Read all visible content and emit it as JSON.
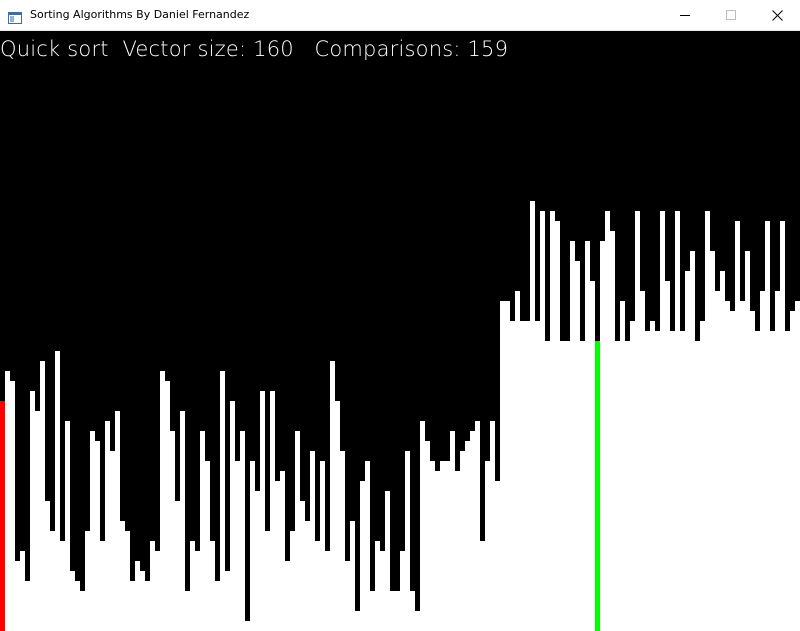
{
  "window": {
    "title": "Sorting Algorithms By Daniel Fernandez",
    "icons": {
      "app": "app-window-icon",
      "minimize": "minimize-icon",
      "maximize": "maximize-icon",
      "close": "close-icon"
    }
  },
  "status": {
    "algorithm": "Quick sort",
    "vector_size_text": "Vector size: 160",
    "comparisons_text": "Comparisons: 159"
  },
  "colors": {
    "background": "#000000",
    "bar": "#ffffff",
    "compare_bar": "#ff0000",
    "pivot_bar": "#00ff00"
  },
  "chart_data": {
    "type": "bar",
    "vector_size": 160,
    "highlight": {
      "compare_index": 0,
      "pivot_index": 119
    },
    "values": [
      230,
      260,
      250,
      70,
      80,
      50,
      240,
      220,
      270,
      130,
      100,
      280,
      90,
      210,
      60,
      50,
      40,
      100,
      200,
      190,
      90,
      210,
      180,
      220,
      110,
      100,
      50,
      70,
      60,
      50,
      90,
      80,
      260,
      250,
      200,
      130,
      220,
      40,
      90,
      80,
      200,
      170,
      90,
      50,
      260,
      60,
      230,
      170,
      200,
      10,
      170,
      140,
      240,
      100,
      240,
      150,
      160,
      70,
      100,
      200,
      130,
      110,
      180,
      90,
      170,
      80,
      270,
      230,
      180,
      70,
      110,
      20,
      150,
      170,
      40,
      90,
      80,
      140,
      40,
      40,
      80,
      180,
      40,
      20,
      210,
      190,
      170,
      160,
      170,
      170,
      200,
      160,
      180,
      190,
      200,
      210,
      90,
      170,
      210,
      150,
      330,
      330,
      310,
      340,
      310,
      310,
      430,
      310,
      420,
      290,
      420,
      410,
      290,
      290,
      390,
      370,
      290,
      390,
      350,
      290,
      390,
      420,
      400,
      290,
      330,
      290,
      310,
      420,
      340,
      300,
      310,
      300,
      420,
      350,
      300,
      420,
      300,
      360,
      380,
      290,
      310,
      420,
      380,
      340,
      360,
      330,
      320,
      410,
      330,
      380,
      320,
      300,
      340,
      410,
      300,
      340,
      410,
      300,
      320,
      330
    ],
    "ylim": [
      0,
      600
    ]
  }
}
